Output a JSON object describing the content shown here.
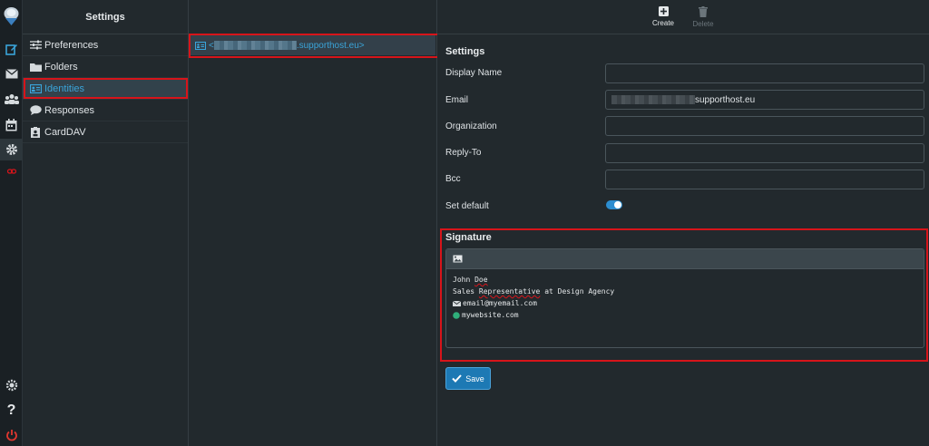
{
  "colors": {
    "accent": "#3aa4d9",
    "highlight": "#d7141a",
    "toggle_on": "#2c8dd0",
    "save_bg": "#1d79b4"
  },
  "rail": {
    "icons": [
      "app-logo-icon",
      "compose-icon",
      "mail-icon",
      "contacts-icon",
      "calendar-icon",
      "settings-icon",
      "link-icon",
      "about-icon",
      "help-icon",
      "logout-icon"
    ]
  },
  "nav": {
    "title": "Settings",
    "items": [
      {
        "label": "Preferences",
        "icon": "sliders-icon"
      },
      {
        "label": "Folders",
        "icon": "folder-icon"
      },
      {
        "label": "Identities",
        "icon": "id-card-icon",
        "selected": true
      },
      {
        "label": "Responses",
        "icon": "comment-icon"
      },
      {
        "label": "CardDAV",
        "icon": "address-book-icon"
      }
    ]
  },
  "identities": {
    "row": {
      "prefix": "<",
      "domain": ".supporthost.eu>"
    }
  },
  "toolbar": {
    "create": "Create",
    "delete": "Delete"
  },
  "settings": {
    "title": "Settings",
    "fields": {
      "display_name": {
        "label": "Display Name",
        "value": ""
      },
      "email": {
        "label": "Email",
        "value_suffix": "supporthost.eu"
      },
      "organization": {
        "label": "Organization",
        "value": ""
      },
      "reply_to": {
        "label": "Reply-To",
        "value": ""
      },
      "bcc": {
        "label": "Bcc",
        "value": ""
      },
      "set_default": {
        "label": "Set default",
        "checked": true
      }
    }
  },
  "signature": {
    "title": "Signature",
    "lines": {
      "name_first": "John",
      "name_last": "Doe",
      "role_a": "Sales",
      "role_b": "Representative",
      "role_c": "at Design Agency",
      "email": "email@myemail.com",
      "website": "mywebsite.com"
    }
  },
  "save_label": "Save"
}
